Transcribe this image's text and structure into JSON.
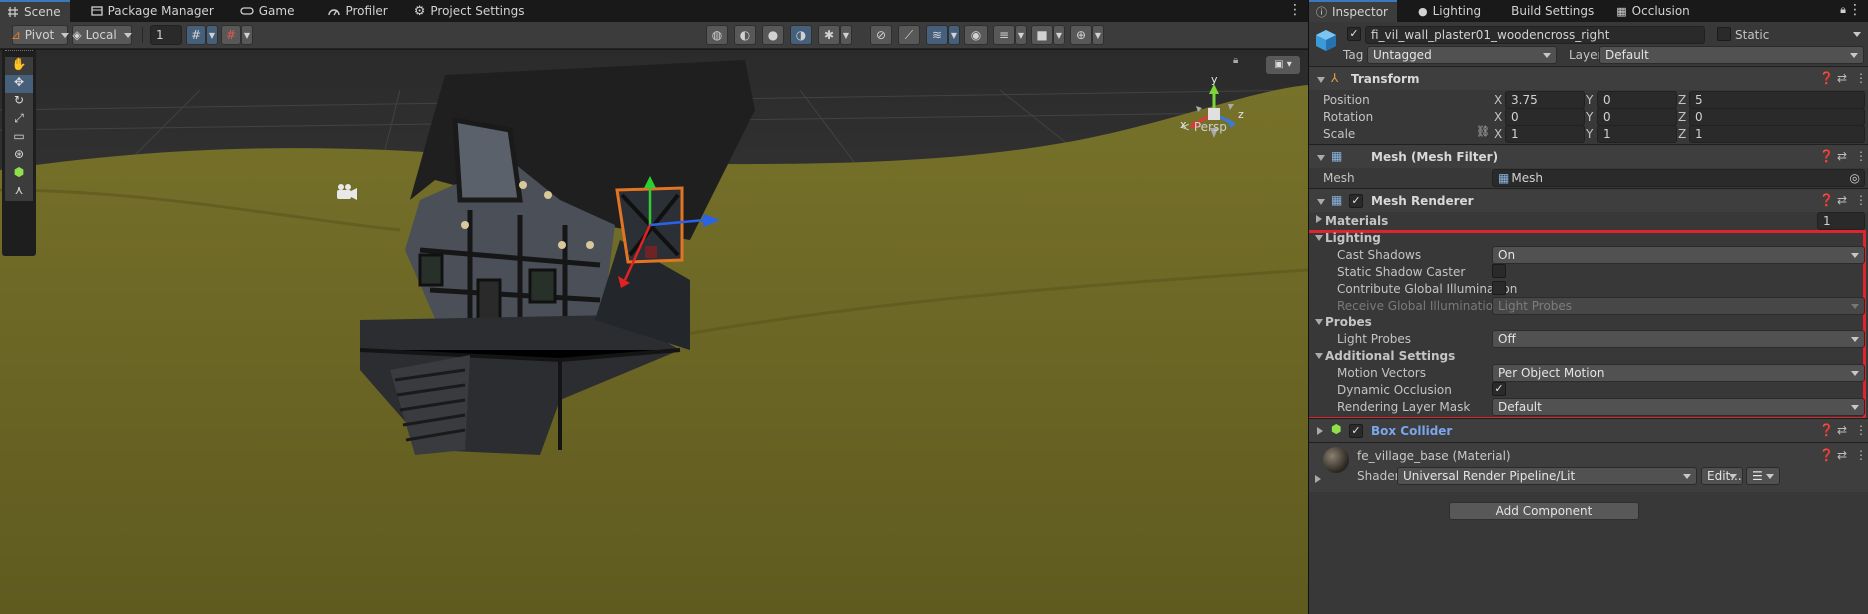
{
  "left_tabs": [
    {
      "label": "Scene",
      "icon": "hash-icon",
      "active": true
    },
    {
      "label": "Package Manager",
      "icon": "package-icon",
      "active": false
    },
    {
      "label": "Game",
      "icon": "gamepad-icon",
      "active": false
    },
    {
      "label": "Profiler",
      "icon": "profiler-icon",
      "active": false
    },
    {
      "label": "Project Settings",
      "icon": "gear-icon",
      "active": false
    }
  ],
  "right_tabs": [
    {
      "label": "Inspector",
      "icon": "info-icon",
      "active": true
    },
    {
      "label": "Lighting",
      "icon": "bulb-icon",
      "active": false
    },
    {
      "label": "Build Settings",
      "icon": "",
      "active": false
    },
    {
      "label": "Occlusion",
      "icon": "occlusion-icon",
      "active": false
    }
  ],
  "toolbar": {
    "pivot": "Pivot",
    "local": "Local",
    "grid_value": "1"
  },
  "scene": {
    "persp_label": "< Persp",
    "gizmo_y": "y",
    "gizmo_x": "x",
    "gizmo_z": "z"
  },
  "object": {
    "name": "fi_vil_wall_plaster01_woodencross_right",
    "static_label": "Static",
    "tag_label": "Tag",
    "tag_value": "Untagged",
    "layer_label": "Layer",
    "layer_value": "Default"
  },
  "transform": {
    "title": "Transform",
    "position_label": "Position",
    "rotation_label": "Rotation",
    "scale_label": "Scale",
    "axis_x": "X",
    "axis_y": "Y",
    "axis_z": "Z",
    "position": [
      "3.75",
      "0",
      "5"
    ],
    "rotation": [
      "0",
      "0",
      "0"
    ],
    "scale": [
      "1",
      "1",
      "1"
    ]
  },
  "mesh_filter": {
    "title": "Mesh (Mesh Filter)",
    "mesh_label": "Mesh",
    "mesh_value": "Mesh"
  },
  "mesh_renderer": {
    "title": "Mesh Renderer",
    "materials_label": "Materials",
    "materials_count": "1",
    "lighting_label": "Lighting",
    "cast_shadows_label": "Cast Shadows",
    "cast_shadows_value": "On",
    "static_shadow_caster_label": "Static Shadow Caster",
    "contribute_gi_label": "Contribute Global Illumination",
    "receive_gi_label": "Receive Global Illumination",
    "receive_gi_value": "Light Probes",
    "probes_label": "Probes",
    "light_probes_label": "Light Probes",
    "light_probes_value": "Off",
    "additional_label": "Additional Settings",
    "motion_vectors_label": "Motion Vectors",
    "motion_vectors_value": "Per Object Motion",
    "dynamic_occlusion_label": "Dynamic Occlusion",
    "rendering_layer_label": "Rendering Layer Mask",
    "rendering_layer_value": "Default"
  },
  "box_collider": {
    "title": "Box Collider"
  },
  "material": {
    "title": "fe_village_base (Material)",
    "shader_label": "Shader",
    "shader_value": "Universal Render Pipeline/Lit",
    "edit_label": "Edit..."
  },
  "add_component_label": "Add Component",
  "colors": {
    "highlight_box": "#e0242c",
    "accent": "#3a79bb",
    "ground": "#6f6a24"
  }
}
